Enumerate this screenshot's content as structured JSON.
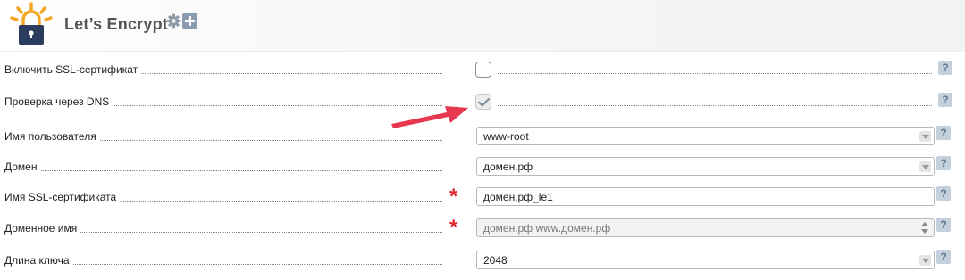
{
  "header": {
    "title": "Let’s Encrypt",
    "logo_icon": "padlock-sun-logo-icon",
    "settings_icon": "gear-icon",
    "add_icon": "plus-icon"
  },
  "help_glyph": "?",
  "required_glyph": "*",
  "form": {
    "enable_ssl": {
      "label": "Включить SSL-сертификат",
      "checked": false
    },
    "dns_check": {
      "label": "Проверка через DNS",
      "checked": true
    },
    "username": {
      "label": "Имя пользователя",
      "value": "www-root"
    },
    "domain": {
      "label": "Домен",
      "value": "домен.рф"
    },
    "ssl_name": {
      "label": "Имя SSL-сертификата",
      "value": "домен.рф_le1",
      "required": true
    },
    "domain_names": {
      "label": "Доменное имя",
      "value": "домен.рф www.домен.рф",
      "required": true
    },
    "key_length": {
      "label": "Длина ключа",
      "value": "2048"
    }
  },
  "colors": {
    "accent_arrow": "#e8384f",
    "required": "#e0232a",
    "logo_lock": "#2c3c5c",
    "logo_rays": "#f5a623"
  }
}
